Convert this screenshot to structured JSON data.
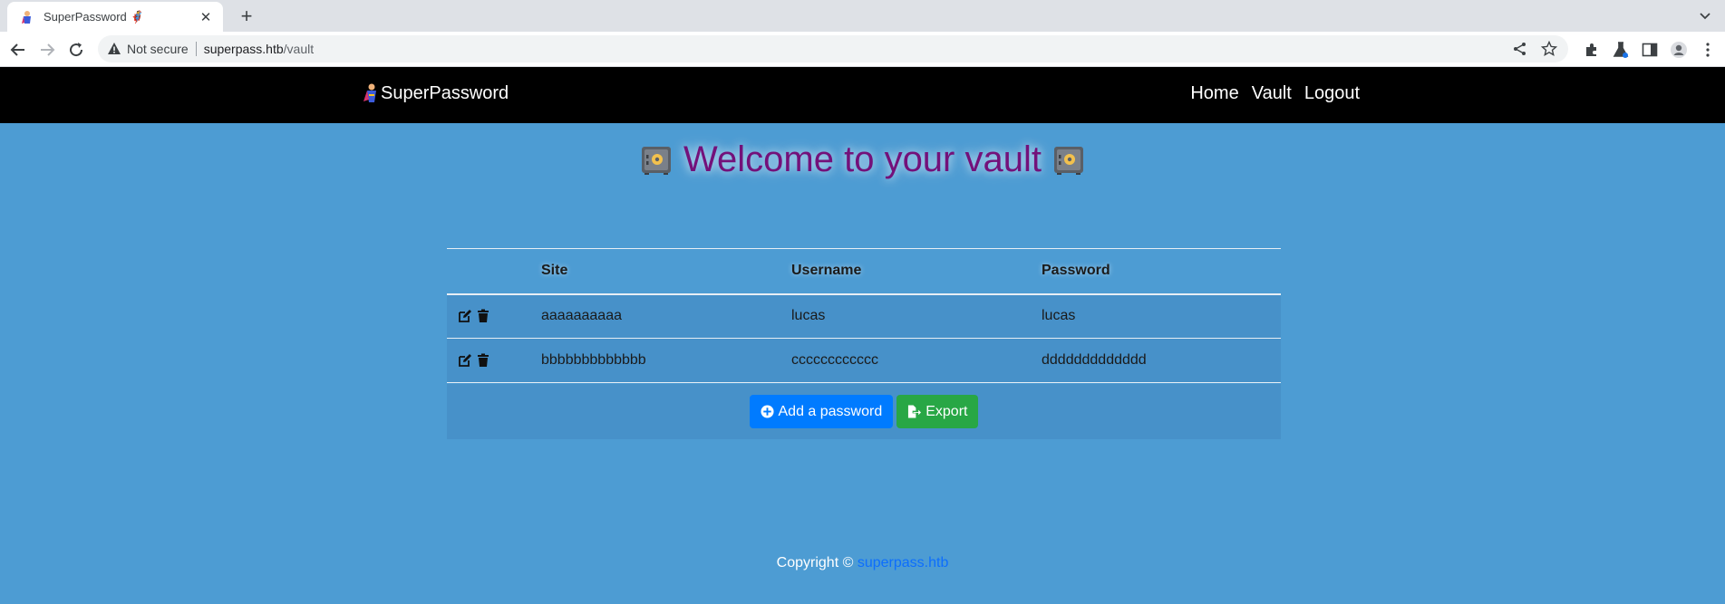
{
  "browser": {
    "tab_title": "SuperPassword 🦸",
    "security_label": "Not secure",
    "url_host": "superpass.htb",
    "url_path": "/vault"
  },
  "site": {
    "brand": "SuperPassword",
    "nav": [
      "Home",
      "Vault",
      "Logout"
    ]
  },
  "page": {
    "title": "Welcome to your vault"
  },
  "table": {
    "headers": [
      "",
      "Site",
      "Username",
      "Password"
    ],
    "rows": [
      {
        "site": "aaaaaaaaaa",
        "username": "lucas",
        "password": "lucas"
      },
      {
        "site": "bbbbbbbbbbbbb",
        "username": "cccccccccccc",
        "password": "ddddddddddddd"
      }
    ]
  },
  "buttons": {
    "add": "Add a password",
    "export": "Export"
  },
  "footer": {
    "text": "Copyright ©",
    "link": "superpass.htb"
  },
  "colors": {
    "page_bg": "#4d9cd3",
    "title": "#73117a",
    "primary": "#007bff",
    "success": "#28a745"
  }
}
